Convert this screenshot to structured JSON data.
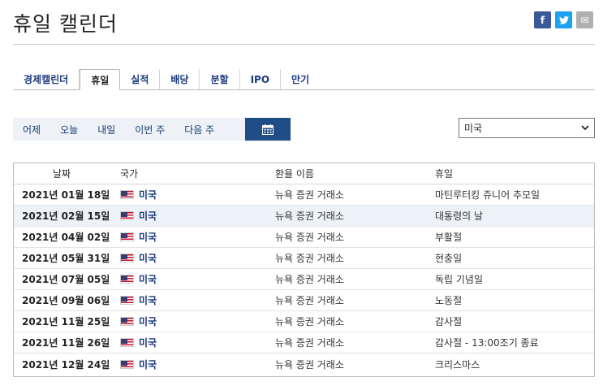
{
  "page": {
    "title": "휴일 캘린더",
    "social": [
      {
        "name": "facebook-icon",
        "glyph": "f"
      },
      {
        "name": "twitter-icon",
        "glyph": "t"
      },
      {
        "name": "mail-icon",
        "glyph": "✉"
      }
    ]
  },
  "tabs": [
    {
      "label": "경제캘린더",
      "active": false
    },
    {
      "label": "휴일",
      "active": true
    },
    {
      "label": "실적",
      "active": false
    },
    {
      "label": "배당",
      "active": false
    },
    {
      "label": "분할",
      "active": false
    },
    {
      "label": "IPO",
      "active": false
    },
    {
      "label": "만기",
      "active": false
    }
  ],
  "datebar": {
    "yesterday": "어제",
    "today": "오늘",
    "tomorrow": "내일",
    "this_week": "이번 주",
    "next_week": "다음 주",
    "calendar_icon": "calendar-icon"
  },
  "country_select": {
    "value": "미국"
  },
  "table": {
    "headers": {
      "date": "날짜",
      "country": "국가",
      "exchange": "환율 이름",
      "holiday": "휴일"
    },
    "rows": [
      {
        "date": "2021년 01월 18일",
        "country": "미국",
        "exchange": "뉴욕 증권 거래소",
        "holiday": "마틴루터킹 쥬니어 추모일",
        "highlight": false
      },
      {
        "date": "2021년 02월 15일",
        "country": "미국",
        "exchange": "뉴욕 증권 거래소",
        "holiday": "대통령의 날",
        "highlight": true
      },
      {
        "date": "2021년 04월 02일",
        "country": "미국",
        "exchange": "뉴욕 증권 거래소",
        "holiday": "부활절",
        "highlight": false
      },
      {
        "date": "2021년 05월 31일",
        "country": "미국",
        "exchange": "뉴욕 증권 거래소",
        "holiday": "현충일",
        "highlight": false
      },
      {
        "date": "2021년 07월 05일",
        "country": "미국",
        "exchange": "뉴욕 증권 거래소",
        "holiday": "독립 기념일",
        "highlight": false
      },
      {
        "date": "2021년 09월 06일",
        "country": "미국",
        "exchange": "뉴욕 증권 거래소",
        "holiday": "노동절",
        "highlight": false
      },
      {
        "date": "2021년 11월 25일",
        "country": "미국",
        "exchange": "뉴욕 증권 거래소",
        "holiday": "감사절",
        "highlight": false
      },
      {
        "date": "2021년 11월 26일",
        "country": "미국",
        "exchange": "뉴욕 증권 거래소",
        "holiday": "감사절 - 13:00조기 종료",
        "highlight": false
      },
      {
        "date": "2021년 12월 24일",
        "country": "미국",
        "exchange": "뉴욕 증권 거래소",
        "holiday": "크리스마스",
        "highlight": false
      }
    ]
  },
  "colors": {
    "accent": "#1f4d86",
    "link": "#1a3a7a",
    "highlight_row": "#edf2f9"
  }
}
